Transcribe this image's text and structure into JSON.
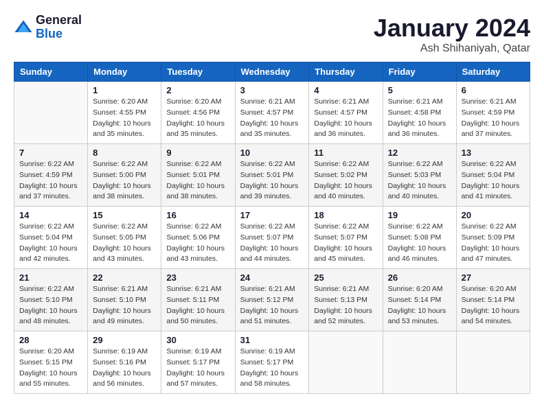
{
  "header": {
    "logo": {
      "line1": "General",
      "line2": "Blue"
    },
    "title": "January 2024",
    "location": "Ash Shihaniyah, Qatar"
  },
  "columns": [
    "Sunday",
    "Monday",
    "Tuesday",
    "Wednesday",
    "Thursday",
    "Friday",
    "Saturday"
  ],
  "weeks": [
    [
      {
        "day": "",
        "empty": true
      },
      {
        "day": "1",
        "sunrise": "6:20 AM",
        "sunset": "4:55 PM",
        "daylight": "10 hours and 35 minutes."
      },
      {
        "day": "2",
        "sunrise": "6:20 AM",
        "sunset": "4:56 PM",
        "daylight": "10 hours and 35 minutes."
      },
      {
        "day": "3",
        "sunrise": "6:21 AM",
        "sunset": "4:57 PM",
        "daylight": "10 hours and 35 minutes."
      },
      {
        "day": "4",
        "sunrise": "6:21 AM",
        "sunset": "4:57 PM",
        "daylight": "10 hours and 36 minutes."
      },
      {
        "day": "5",
        "sunrise": "6:21 AM",
        "sunset": "4:58 PM",
        "daylight": "10 hours and 36 minutes."
      },
      {
        "day": "6",
        "sunrise": "6:21 AM",
        "sunset": "4:59 PM",
        "daylight": "10 hours and 37 minutes."
      }
    ],
    [
      {
        "day": "7",
        "sunrise": "6:22 AM",
        "sunset": "4:59 PM",
        "daylight": "10 hours and 37 minutes."
      },
      {
        "day": "8",
        "sunrise": "6:22 AM",
        "sunset": "5:00 PM",
        "daylight": "10 hours and 38 minutes."
      },
      {
        "day": "9",
        "sunrise": "6:22 AM",
        "sunset": "5:01 PM",
        "daylight": "10 hours and 38 minutes."
      },
      {
        "day": "10",
        "sunrise": "6:22 AM",
        "sunset": "5:01 PM",
        "daylight": "10 hours and 39 minutes."
      },
      {
        "day": "11",
        "sunrise": "6:22 AM",
        "sunset": "5:02 PM",
        "daylight": "10 hours and 40 minutes."
      },
      {
        "day": "12",
        "sunrise": "6:22 AM",
        "sunset": "5:03 PM",
        "daylight": "10 hours and 40 minutes."
      },
      {
        "day": "13",
        "sunrise": "6:22 AM",
        "sunset": "5:04 PM",
        "daylight": "10 hours and 41 minutes."
      }
    ],
    [
      {
        "day": "14",
        "sunrise": "6:22 AM",
        "sunset": "5:04 PM",
        "daylight": "10 hours and 42 minutes."
      },
      {
        "day": "15",
        "sunrise": "6:22 AM",
        "sunset": "5:05 PM",
        "daylight": "10 hours and 43 minutes."
      },
      {
        "day": "16",
        "sunrise": "6:22 AM",
        "sunset": "5:06 PM",
        "daylight": "10 hours and 43 minutes."
      },
      {
        "day": "17",
        "sunrise": "6:22 AM",
        "sunset": "5:07 PM",
        "daylight": "10 hours and 44 minutes."
      },
      {
        "day": "18",
        "sunrise": "6:22 AM",
        "sunset": "5:07 PM",
        "daylight": "10 hours and 45 minutes."
      },
      {
        "day": "19",
        "sunrise": "6:22 AM",
        "sunset": "5:08 PM",
        "daylight": "10 hours and 46 minutes."
      },
      {
        "day": "20",
        "sunrise": "6:22 AM",
        "sunset": "5:09 PM",
        "daylight": "10 hours and 47 minutes."
      }
    ],
    [
      {
        "day": "21",
        "sunrise": "6:22 AM",
        "sunset": "5:10 PM",
        "daylight": "10 hours and 48 minutes."
      },
      {
        "day": "22",
        "sunrise": "6:21 AM",
        "sunset": "5:10 PM",
        "daylight": "10 hours and 49 minutes."
      },
      {
        "day": "23",
        "sunrise": "6:21 AM",
        "sunset": "5:11 PM",
        "daylight": "10 hours and 50 minutes."
      },
      {
        "day": "24",
        "sunrise": "6:21 AM",
        "sunset": "5:12 PM",
        "daylight": "10 hours and 51 minutes."
      },
      {
        "day": "25",
        "sunrise": "6:21 AM",
        "sunset": "5:13 PM",
        "daylight": "10 hours and 52 minutes."
      },
      {
        "day": "26",
        "sunrise": "6:20 AM",
        "sunset": "5:14 PM",
        "daylight": "10 hours and 53 minutes."
      },
      {
        "day": "27",
        "sunrise": "6:20 AM",
        "sunset": "5:14 PM",
        "daylight": "10 hours and 54 minutes."
      }
    ],
    [
      {
        "day": "28",
        "sunrise": "6:20 AM",
        "sunset": "5:15 PM",
        "daylight": "10 hours and 55 minutes."
      },
      {
        "day": "29",
        "sunrise": "6:19 AM",
        "sunset": "5:16 PM",
        "daylight": "10 hours and 56 minutes."
      },
      {
        "day": "30",
        "sunrise": "6:19 AM",
        "sunset": "5:17 PM",
        "daylight": "10 hours and 57 minutes."
      },
      {
        "day": "31",
        "sunrise": "6:19 AM",
        "sunset": "5:17 PM",
        "daylight": "10 hours and 58 minutes."
      },
      {
        "day": "",
        "empty": true
      },
      {
        "day": "",
        "empty": true
      },
      {
        "day": "",
        "empty": true
      }
    ]
  ]
}
